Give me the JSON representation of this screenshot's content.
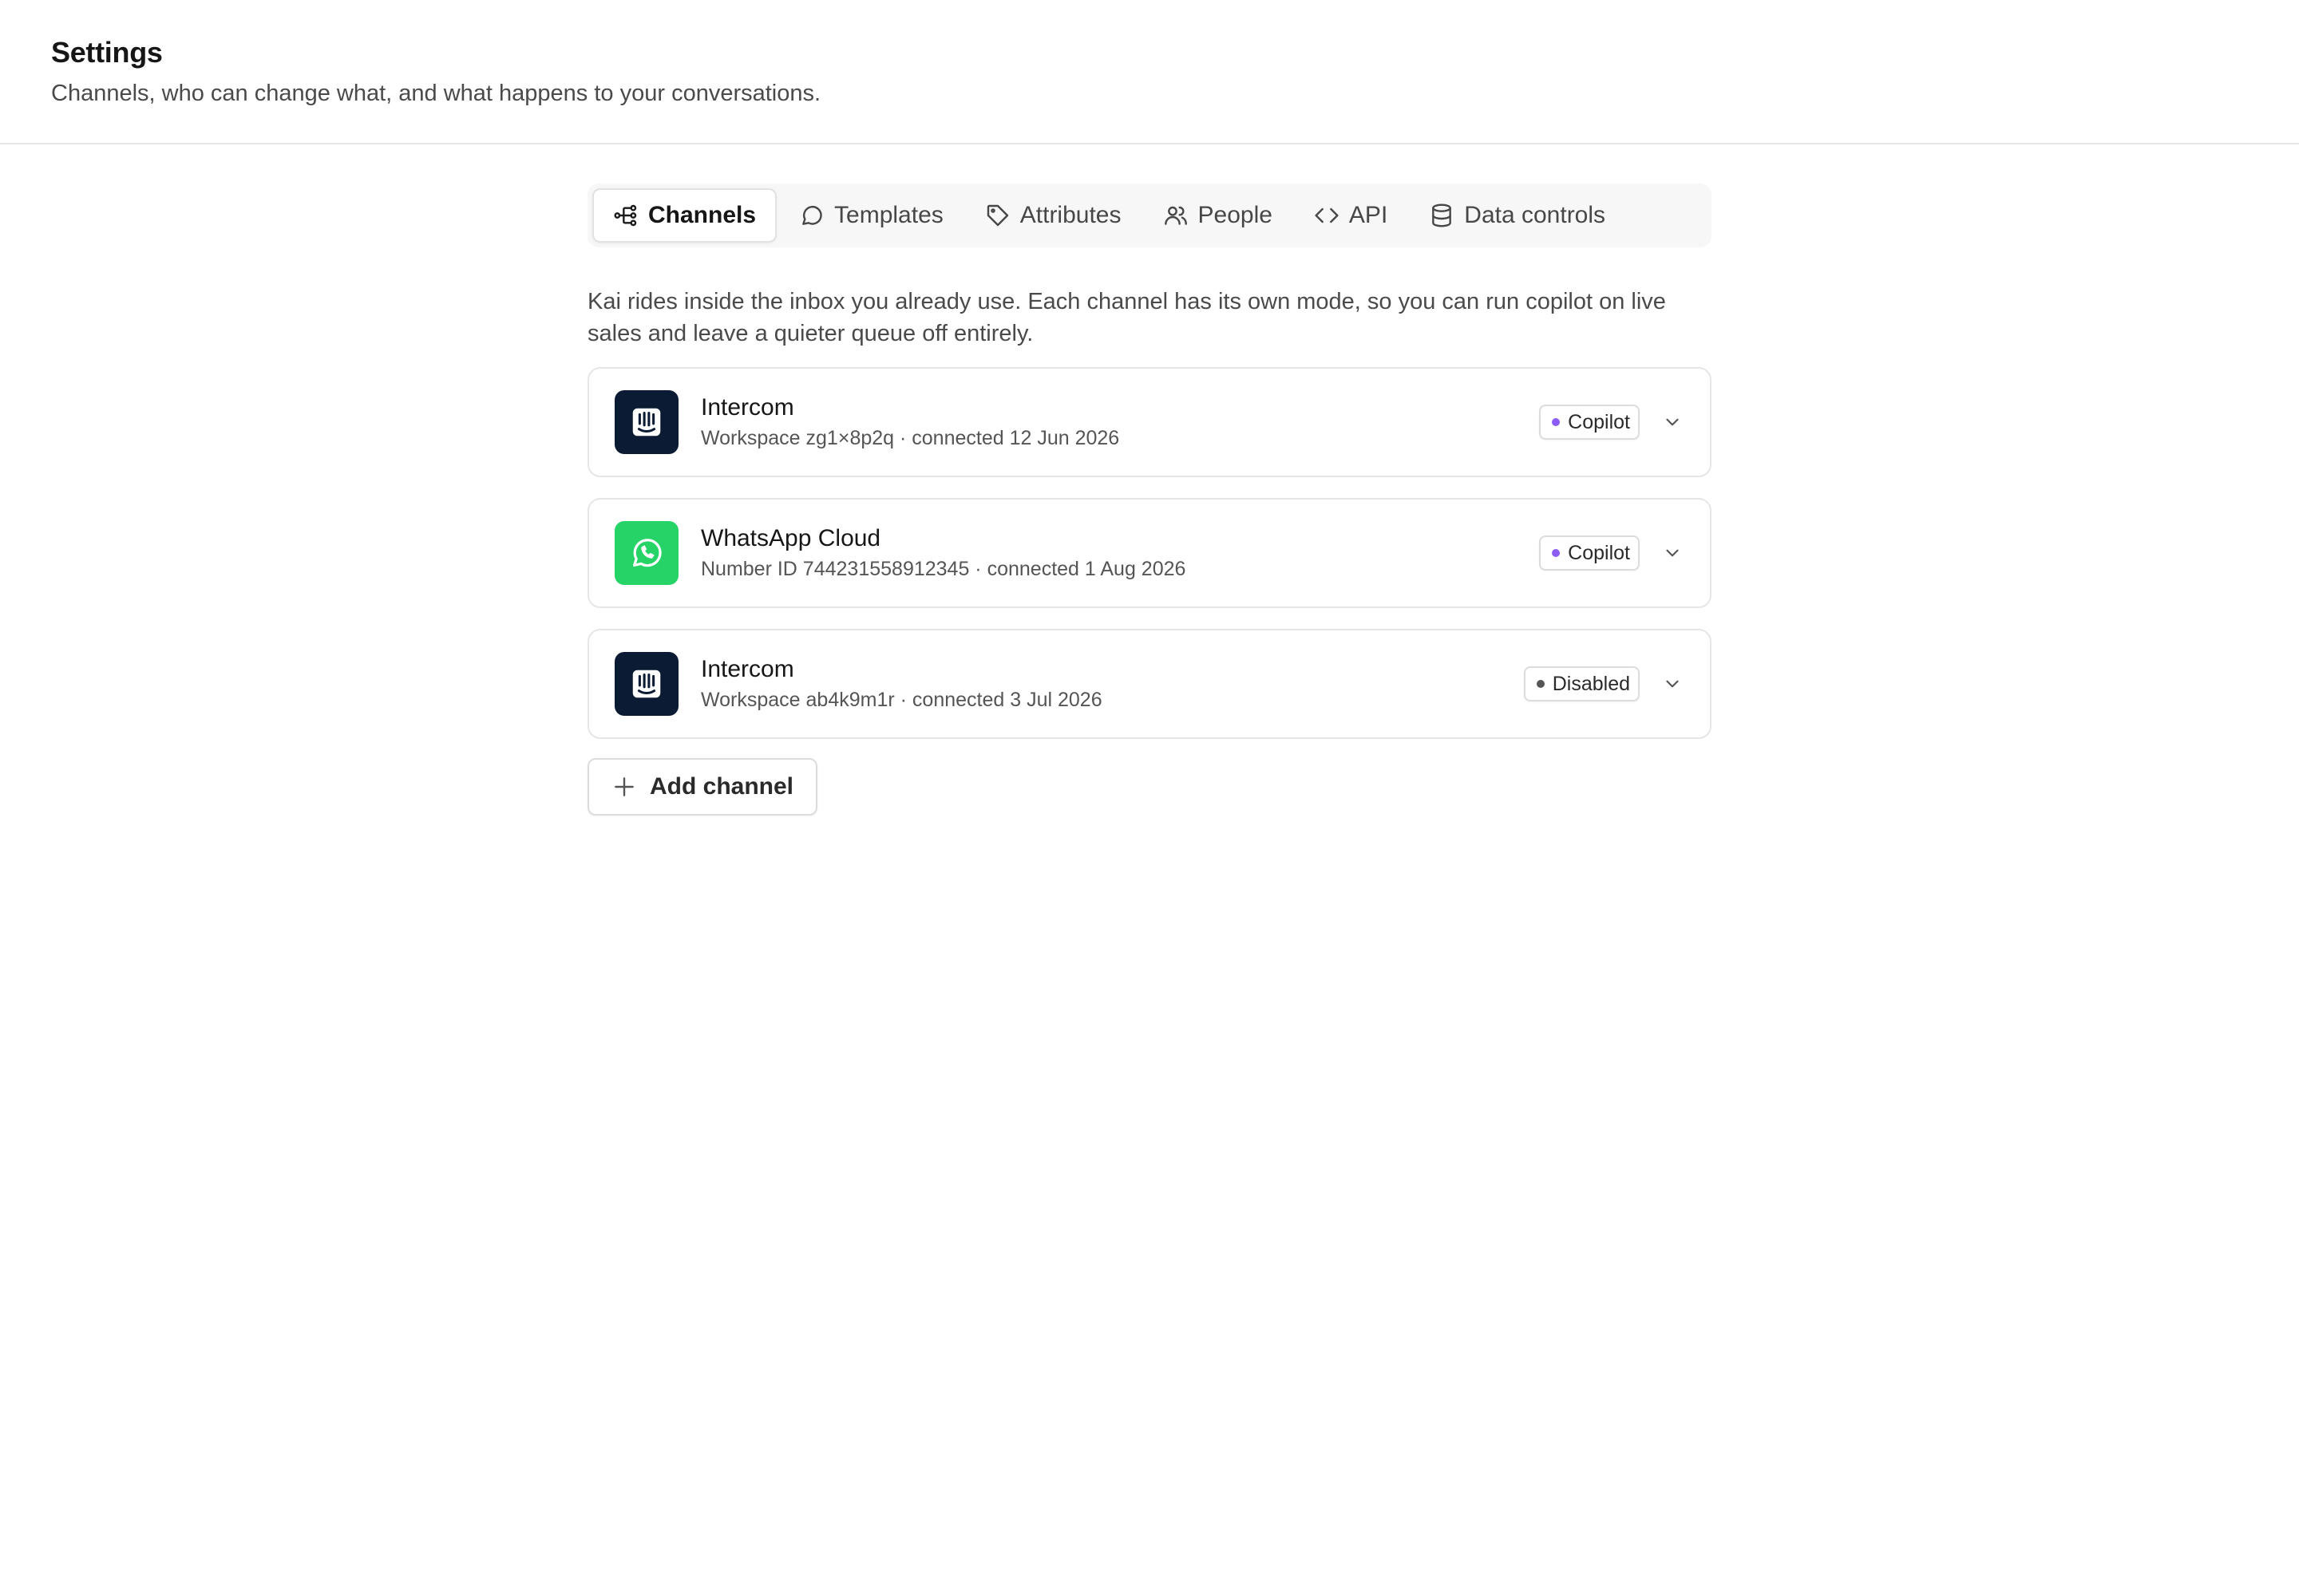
{
  "header": {
    "title": "Settings",
    "subtitle": "Channels, who can change what, and what happens to your conversations."
  },
  "tabs": [
    {
      "label": "Channels",
      "icon": "channels-icon",
      "active": true
    },
    {
      "label": "Templates",
      "icon": "chat-bubble-icon",
      "active": false
    },
    {
      "label": "Attributes",
      "icon": "tag-icon",
      "active": false
    },
    {
      "label": "People",
      "icon": "people-icon",
      "active": false
    },
    {
      "label": "API",
      "icon": "code-icon",
      "active": false
    },
    {
      "label": "Data controls",
      "icon": "database-icon",
      "active": false
    }
  ],
  "intro": "Kai rides inside the inbox you already use. Each channel has its own mode, so you can run copilot on live sales and leave a quieter queue off entirely.",
  "channels": [
    {
      "name": "Intercom",
      "detail": "Workspace zg1×8p2q · connected 12 Jun 2026",
      "mode": "Copilot",
      "logo": "intercom-logo",
      "logo_color": "#0b1b33",
      "mode_color": "#8b5cf6"
    },
    {
      "name": "WhatsApp Cloud",
      "detail": "Number ID 744231558912345 · connected 1 Aug 2026",
      "mode": "Copilot",
      "logo": "whatsapp-logo",
      "logo_color": "#25d366",
      "mode_color": "#8b5cf6"
    },
    {
      "name": "Intercom",
      "detail": "Workspace ab4k9m1r · connected 3 Jul 2026",
      "mode": "Disabled",
      "logo": "intercom-logo",
      "logo_color": "#0b1b33",
      "mode_color": "#555555"
    }
  ],
  "add_channel_label": "Add channel"
}
